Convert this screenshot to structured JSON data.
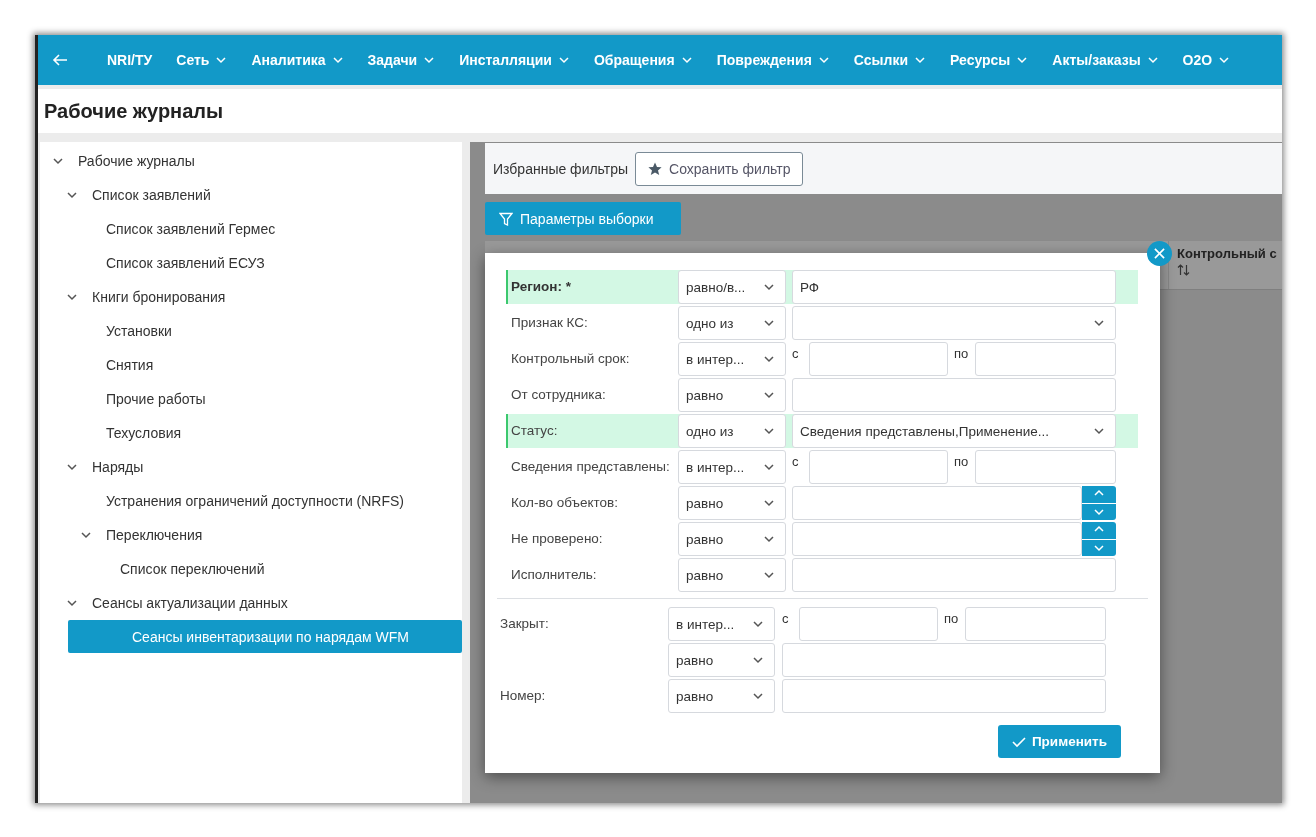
{
  "nav": {
    "items": [
      {
        "label": "NRI/ТУ",
        "has_menu": false
      },
      {
        "label": "Сеть",
        "has_menu": true
      },
      {
        "label": "Аналитика",
        "has_menu": true
      },
      {
        "label": "Задачи",
        "has_menu": true
      },
      {
        "label": "Инсталляции",
        "has_menu": true
      },
      {
        "label": "Обращения",
        "has_menu": true
      },
      {
        "label": "Повреждения",
        "has_menu": true
      },
      {
        "label": "Ссылки",
        "has_menu": true
      },
      {
        "label": "Ресурсы",
        "has_menu": true
      },
      {
        "label": "Акты/заказы",
        "has_menu": true
      },
      {
        "label": "O2O",
        "has_menu": true
      }
    ]
  },
  "page_title": "Рабочие журналы",
  "sidebar": {
    "tree": [
      {
        "label": "Рабочие журналы",
        "expanded": true,
        "selected": false,
        "children": [
          {
            "label": "Список заявлений",
            "expanded": true,
            "selected": false,
            "children": [
              {
                "label": "Список заявлений Гермес",
                "selected": false
              },
              {
                "label": "Список заявлений ЕСУЗ",
                "selected": false
              }
            ]
          },
          {
            "label": "Книги бронирования",
            "expanded": true,
            "selected": false,
            "children": [
              {
                "label": "Установки",
                "selected": false
              },
              {
                "label": "Снятия",
                "selected": false
              },
              {
                "label": "Прочие работы",
                "selected": false
              },
              {
                "label": "Техусловия",
                "selected": false
              }
            ]
          },
          {
            "label": "Наряды",
            "expanded": true,
            "selected": false,
            "children": [
              {
                "label": "Устранения ограничений доступности (NRFS)",
                "selected": false
              },
              {
                "label": "Переключения",
                "expanded": true,
                "selected": false,
                "children": [
                  {
                    "label": "Список переключений",
                    "selected": false
                  }
                ]
              }
            ]
          },
          {
            "label": "Сеансы актуализации данных",
            "expanded": true,
            "selected": false,
            "children": [
              {
                "label": "Сеансы инвентаризации по нарядам WFM",
                "selected": true
              }
            ]
          }
        ]
      }
    ]
  },
  "favorites": {
    "label": "Избранные фильтры",
    "save_button": "Сохранить фильтр"
  },
  "params_button": "Параметры выборки",
  "table": {
    "columns": [
      {
        "label": "Контрольный с"
      }
    ]
  },
  "dialog": {
    "filters": [
      {
        "label": "Регион: *",
        "required": true,
        "highlighted": true,
        "operator": "равно/в...",
        "kind": "text",
        "value": "РФ"
      },
      {
        "label": "Признак КС:",
        "required": false,
        "highlighted": false,
        "operator": "одно из",
        "kind": "dropdown"
      },
      {
        "label": "Контрольный срок:",
        "required": false,
        "highlighted": false,
        "operator": "в интер...",
        "kind": "range",
        "from_label": "с",
        "to_label": "по"
      },
      {
        "label": "От сотрудника:",
        "required": false,
        "highlighted": false,
        "operator": "равно",
        "kind": "text"
      },
      {
        "label": "Статус:",
        "required": false,
        "highlighted": true,
        "operator": "одно из",
        "kind": "dropdown",
        "value": "Сведения представлены,Применение..."
      },
      {
        "label": "Сведения представлены:",
        "required": false,
        "highlighted": false,
        "operator": "в интер...",
        "kind": "range",
        "from_label": "с",
        "to_label": "по"
      },
      {
        "label": "Кол-во объектов:",
        "required": false,
        "highlighted": false,
        "operator": "равно",
        "kind": "number"
      },
      {
        "label": "Не проверено:",
        "required": false,
        "highlighted": false,
        "operator": "равно",
        "kind": "number"
      },
      {
        "label": "Исполнитель:",
        "required": false,
        "highlighted": false,
        "operator": "равно",
        "kind": "text"
      }
    ],
    "extra_filters": [
      {
        "label": "Закрыт:",
        "operator": "в интер...",
        "kind": "range",
        "from_label": "с",
        "to_label": "по"
      },
      {
        "operator": "равно",
        "kind": "text"
      },
      {
        "label": "Номер:",
        "operator": "равно",
        "kind": "text"
      }
    ],
    "apply_button": "Применить"
  }
}
